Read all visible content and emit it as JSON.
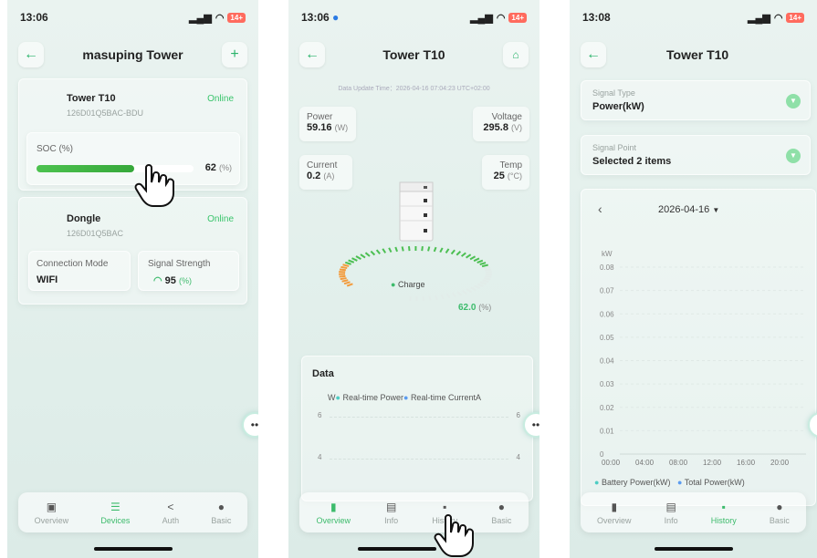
{
  "screen1": {
    "time": "13:06",
    "battery": "14+",
    "title": "masuping Tower",
    "device": {
      "name": "Tower T10",
      "serial": "126D01Q5BAC-BDU",
      "status": "Online"
    },
    "soc": {
      "label": "SOC (%)",
      "value": "62",
      "unit": "(%)",
      "fraction": 0.62
    },
    "dongle": {
      "name": "Dongle",
      "serial": "126D01Q5BAC",
      "status": "Online",
      "conn_label": "Connection Mode",
      "conn_value": "WIFI",
      "signal_label": "Signal Strength",
      "signal_value": "95",
      "signal_unit": "(%)"
    },
    "tabs": [
      "Overview",
      "Devices",
      "Auth",
      "Basic"
    ],
    "active_tab": 1
  },
  "screen2": {
    "time": "13:06",
    "battery": "14+",
    "title": "Tower T10",
    "update_time": "Data Update Time：2026-04-16 07:04:23 UTC+02:00",
    "power": {
      "label": "Power",
      "value": "59.16",
      "unit": "(W)"
    },
    "voltage": {
      "label": "Voltage",
      "value": "295.8",
      "unit": "(V)"
    },
    "current": {
      "label": "Current",
      "value": "0.2",
      "unit": "(A)"
    },
    "temp": {
      "label": "Temp",
      "value": "25",
      "unit": "(°C)"
    },
    "charge_label": "Charge",
    "percent": {
      "value": "62.0",
      "unit": "(%)",
      "fraction": 0.62
    },
    "data_title": "Data",
    "legend_left_unit": "W",
    "legend_right_unit": "A",
    "legend": [
      "Real-time Power",
      "Real-time Current"
    ],
    "ticks": [
      "6",
      "4"
    ],
    "tabs": [
      "Overview",
      "Info",
      "History",
      "Basic"
    ],
    "active_tab": 0
  },
  "screen3": {
    "time": "13:08",
    "battery": "14+",
    "title": "Tower T10",
    "signal_type_label": "Signal Type",
    "signal_type_value": "Power(kW)",
    "signal_point_label": "Signal Point",
    "signal_point_value": "Selected 2 items",
    "date": "2026-04-16",
    "chart_data": {
      "type": "line",
      "ylabel": "kW",
      "ylim": [
        0,
        0.08
      ],
      "yticks": [
        "0.08",
        "0.07",
        "0.06",
        "0.05",
        "0.04",
        "0.03",
        "0.02",
        "0.01",
        "0"
      ],
      "categories": [
        "00:00",
        "04:00",
        "08:00",
        "12:00",
        "16:00",
        "20:00"
      ],
      "series": [
        {
          "name": "Battery Power(kW)",
          "values": [],
          "color": "#4ecdc4"
        },
        {
          "name": "Total Power(kW)",
          "values": [],
          "color": "#5b9cf0"
        }
      ]
    },
    "tabs": [
      "Overview",
      "Info",
      "History",
      "Basic"
    ],
    "active_tab": 2
  },
  "colors": {
    "accent": "#3dbb6c",
    "battery": "#ff6b5e",
    "teal": "#4ecdc4",
    "blue": "#5b9cf0"
  },
  "icons": {
    "back": "arrow-left-icon",
    "add": "plus-icon",
    "report": "report-icon",
    "hand": "hand-pointer-icon"
  }
}
